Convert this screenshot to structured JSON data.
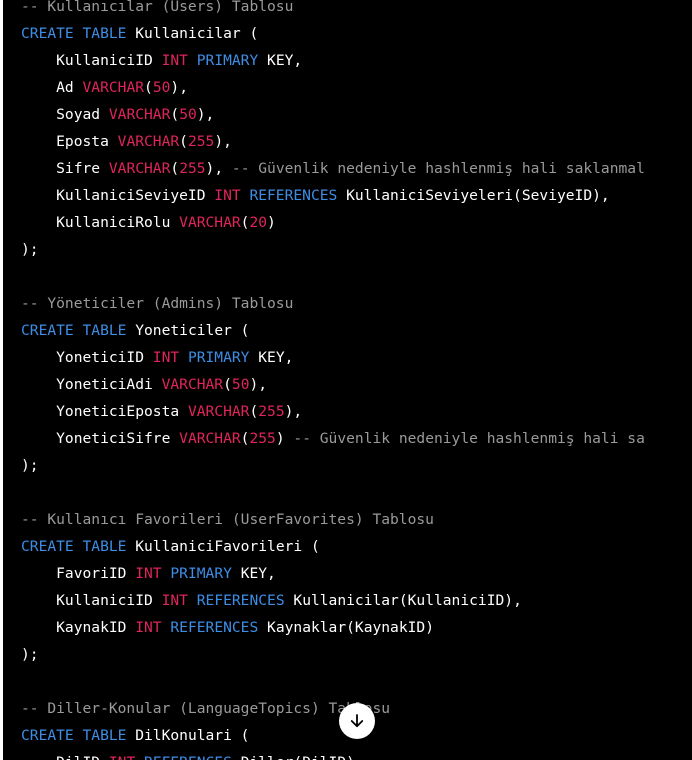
{
  "code": {
    "lines": [
      [
        {
          "t": "-- Kullanıcılar (Users) Tablosu",
          "c": "comment"
        }
      ],
      [
        {
          "t": "CREATE",
          "c": "keyword"
        },
        {
          "t": " ",
          "c": "plain"
        },
        {
          "t": "TABLE",
          "c": "keyword"
        },
        {
          "t": " Kullanicilar (",
          "c": "plain"
        }
      ],
      [
        {
          "t": "    KullaniciID ",
          "c": "plain"
        },
        {
          "t": "INT",
          "c": "type"
        },
        {
          "t": " ",
          "c": "plain"
        },
        {
          "t": "PRIMARY",
          "c": "keyword"
        },
        {
          "t": " KEY,",
          "c": "plain"
        }
      ],
      [
        {
          "t": "    Ad ",
          "c": "plain"
        },
        {
          "t": "VARCHAR",
          "c": "type"
        },
        {
          "t": "(",
          "c": "plain"
        },
        {
          "t": "50",
          "c": "number"
        },
        {
          "t": "),",
          "c": "plain"
        }
      ],
      [
        {
          "t": "    Soyad ",
          "c": "plain"
        },
        {
          "t": "VARCHAR",
          "c": "type"
        },
        {
          "t": "(",
          "c": "plain"
        },
        {
          "t": "50",
          "c": "number"
        },
        {
          "t": "),",
          "c": "plain"
        }
      ],
      [
        {
          "t": "    Eposta ",
          "c": "plain"
        },
        {
          "t": "VARCHAR",
          "c": "type"
        },
        {
          "t": "(",
          "c": "plain"
        },
        {
          "t": "255",
          "c": "number"
        },
        {
          "t": "),",
          "c": "plain"
        }
      ],
      [
        {
          "t": "    Sifre ",
          "c": "plain"
        },
        {
          "t": "VARCHAR",
          "c": "type"
        },
        {
          "t": "(",
          "c": "plain"
        },
        {
          "t": "255",
          "c": "number"
        },
        {
          "t": "), ",
          "c": "plain"
        },
        {
          "t": "-- Güvenlik nedeniyle hashlenmiş hali saklanmal",
          "c": "comment"
        }
      ],
      [
        {
          "t": "    KullaniciSeviyeID ",
          "c": "plain"
        },
        {
          "t": "INT",
          "c": "type"
        },
        {
          "t": " ",
          "c": "plain"
        },
        {
          "t": "REFERENCES",
          "c": "keyword"
        },
        {
          "t": " KullaniciSeviyeleri(SeviyeID),",
          "c": "plain"
        }
      ],
      [
        {
          "t": "    KullaniciRolu ",
          "c": "plain"
        },
        {
          "t": "VARCHAR",
          "c": "type"
        },
        {
          "t": "(",
          "c": "plain"
        },
        {
          "t": "20",
          "c": "number"
        },
        {
          "t": ")",
          "c": "plain"
        }
      ],
      [
        {
          "t": ");",
          "c": "plain"
        }
      ],
      [],
      [
        {
          "t": "-- Yöneticiler (Admins) Tablosu",
          "c": "comment"
        }
      ],
      [
        {
          "t": "CREATE",
          "c": "keyword"
        },
        {
          "t": " ",
          "c": "plain"
        },
        {
          "t": "TABLE",
          "c": "keyword"
        },
        {
          "t": " Yoneticiler (",
          "c": "plain"
        }
      ],
      [
        {
          "t": "    YoneticiID ",
          "c": "plain"
        },
        {
          "t": "INT",
          "c": "type"
        },
        {
          "t": " ",
          "c": "plain"
        },
        {
          "t": "PRIMARY",
          "c": "keyword"
        },
        {
          "t": " KEY,",
          "c": "plain"
        }
      ],
      [
        {
          "t": "    YoneticiAdi ",
          "c": "plain"
        },
        {
          "t": "VARCHAR",
          "c": "type"
        },
        {
          "t": "(",
          "c": "plain"
        },
        {
          "t": "50",
          "c": "number"
        },
        {
          "t": "),",
          "c": "plain"
        }
      ],
      [
        {
          "t": "    YoneticiEposta ",
          "c": "plain"
        },
        {
          "t": "VARCHAR",
          "c": "type"
        },
        {
          "t": "(",
          "c": "plain"
        },
        {
          "t": "255",
          "c": "number"
        },
        {
          "t": "),",
          "c": "plain"
        }
      ],
      [
        {
          "t": "    YoneticiSifre ",
          "c": "plain"
        },
        {
          "t": "VARCHAR",
          "c": "type"
        },
        {
          "t": "(",
          "c": "plain"
        },
        {
          "t": "255",
          "c": "number"
        },
        {
          "t": ") ",
          "c": "plain"
        },
        {
          "t": "-- Güvenlik nedeniyle hashlenmiş hali sa",
          "c": "comment"
        }
      ],
      [
        {
          "t": ");",
          "c": "plain"
        }
      ],
      [],
      [
        {
          "t": "-- Kullanıcı Favorileri (UserFavorites) Tablosu",
          "c": "comment"
        }
      ],
      [
        {
          "t": "CREATE",
          "c": "keyword"
        },
        {
          "t": " ",
          "c": "plain"
        },
        {
          "t": "TABLE",
          "c": "keyword"
        },
        {
          "t": " KullaniciFavorileri (",
          "c": "plain"
        }
      ],
      [
        {
          "t": "    FavoriID ",
          "c": "plain"
        },
        {
          "t": "INT",
          "c": "type"
        },
        {
          "t": " ",
          "c": "plain"
        },
        {
          "t": "PRIMARY",
          "c": "keyword"
        },
        {
          "t": " KEY,",
          "c": "plain"
        }
      ],
      [
        {
          "t": "    KullaniciID ",
          "c": "plain"
        },
        {
          "t": "INT",
          "c": "type"
        },
        {
          "t": " ",
          "c": "plain"
        },
        {
          "t": "REFERENCES",
          "c": "keyword"
        },
        {
          "t": " Kullanicilar(KullaniciID),",
          "c": "plain"
        }
      ],
      [
        {
          "t": "    KaynakID ",
          "c": "plain"
        },
        {
          "t": "INT",
          "c": "type"
        },
        {
          "t": " ",
          "c": "plain"
        },
        {
          "t": "REFERENCES",
          "c": "keyword"
        },
        {
          "t": " Kaynaklar(KaynakID)",
          "c": "plain"
        }
      ],
      [
        {
          "t": ");",
          "c": "plain"
        }
      ],
      [],
      [
        {
          "t": "-- Diller-Konular (LanguageTopics) Tablosu",
          "c": "comment"
        }
      ],
      [
        {
          "t": "CREATE",
          "c": "keyword"
        },
        {
          "t": " ",
          "c": "plain"
        },
        {
          "t": "TABLE",
          "c": "keyword"
        },
        {
          "t": " DilKonulari (",
          "c": "plain"
        }
      ],
      [
        {
          "t": "    DilID ",
          "c": "plain"
        },
        {
          "t": "INT",
          "c": "type"
        },
        {
          "t": " ",
          "c": "plain"
        },
        {
          "t": "REFERENCES",
          "c": "keyword"
        },
        {
          "t": " Diller(DilID),",
          "c": "plain"
        }
      ]
    ]
  },
  "scroll_button": {
    "icon": "arrow-down-icon"
  },
  "colors": {
    "background": "#000000",
    "comment": "#9a9a9a",
    "keyword": "#3e8ee6",
    "type": "#e0245c",
    "plain": "#ffffff"
  }
}
